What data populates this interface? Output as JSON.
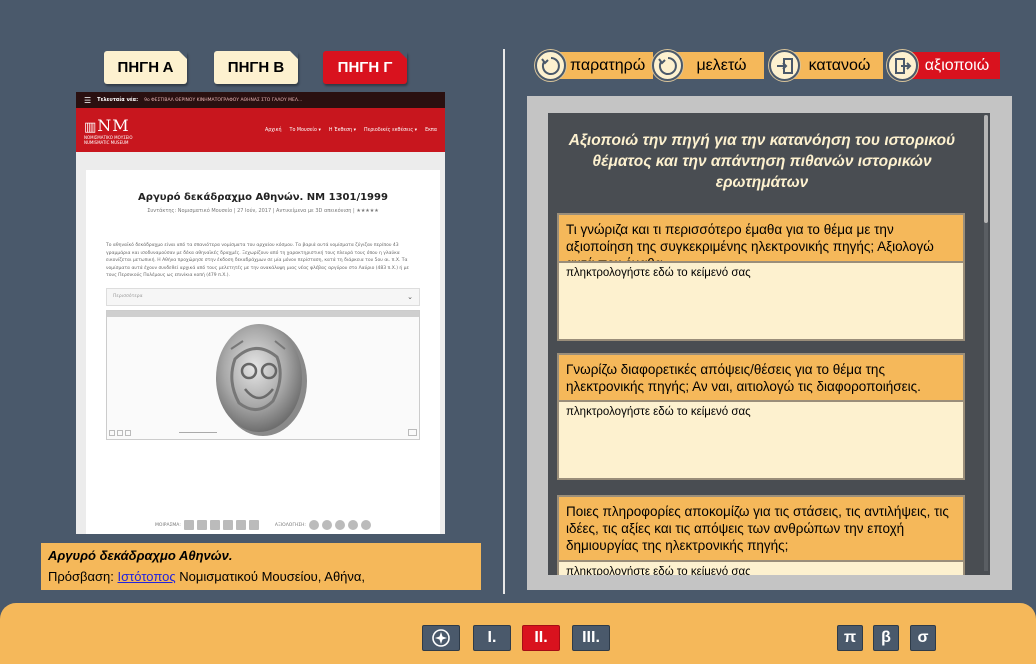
{
  "source_tabs": [
    {
      "label": "ΠΗΓΗ Α",
      "active": false
    },
    {
      "label": "ΠΗΓΗ Β",
      "active": false
    },
    {
      "label": "ΠΗΓΗ Γ",
      "active": true
    }
  ],
  "webpage": {
    "topbar_label": "Τελευταία νέα:",
    "topbar_text": "9ο ΦΕΣΤΙΒΑΛ ΘΕΡΙΝΟΥ ΚΙΝΗΜΑΤΟΓΡΑΦΟΥ ΑΘΗΝΑΣ ΣΤΟ ΓΑΛΟΥ ΜΕΛ...",
    "logo_text": "NM",
    "logo_sub1": "ΝΟΜΙΣΜΑΤΙΚΟ ΜΟΥΣΕΙΟ",
    "logo_sub2": "NUMISMATIC MUSEUM",
    "nav": [
      "Αρχική",
      "Το Μουσείο ▾",
      "Η Έκθεση ▾",
      "Περιοδικές εκθέσεις ▾",
      "Εκπα"
    ],
    "title": "Αργυρό δεκάδραχμο Αθηνών. ΝΜ 1301/1999",
    "meta": "Συντάκτης: Νομισματικό Μουσείο | 27 Ιούν, 2017 | Αντικείμενα με 3D απεικόνιση | ★★★★★",
    "paragraph": "Το αθηναϊκό δεκάδραχμο είναι από τα σπανιότερα νομίσματα του αρχαίου κόσμου. Τα βαριά αυτά νομίσματα ζύγιζαν περίπου 43 γραμμάρια και ισοδυναμούσαν με δέκα αθηναϊκές δραχμές. Ξεχωρίζουν από τη χαρακτηριστική τους πλευρά τους όπου η γλαύκα εικονίζεται μετωπική. Η Αθήνα προχώρησε στην έκδοση δεκαδράχμων σε μία μόνον περίσταση, κατά τη διάρκεια του 5ου αι. π.Χ. Τα νομίσματα αυτά έχουν συνδεθεί αρχικά από τους μελετητές με την ανακάλυψη μιας νέας φλέβας αργύρου στο Λαύριο (483 π.Χ.) ή με τους Περσικούς Πολέμους ως επινίκια κοπή (479 π.Χ.).",
    "select_placeholder": "Περισσότερα",
    "share_label": "ΜΟΙΡΑΣΜΑ:",
    "rate_label": "ΑΞΙΟΛΟΓΗΣΗ:"
  },
  "caption": {
    "title": "Αργυρό δεκάδραχμο Αθηνών.",
    "access_prefix": "Πρόσβαση: ",
    "link_text": "Ιστότοπος",
    "access_suffix": " Νομισματικού Μουσείου, Αθήνα,"
  },
  "steps": [
    {
      "label": "παρατηρώ",
      "icon": "cycle-icon",
      "active": false
    },
    {
      "label": "μελετώ",
      "icon": "cycle-icon",
      "active": false
    },
    {
      "label": "κατανοώ",
      "icon": "enter-icon",
      "active": false
    },
    {
      "label": "αξιοποιώ",
      "icon": "exit-icon",
      "active": true
    }
  ],
  "panel": {
    "heading": "Αξιοποιώ την πηγή για την κατανόηση του ιστορικού θέματος και την απάντηση πιθανών ιστορικών ερωτημάτων",
    "questions": [
      {
        "text": "Τι γνώριζα και τι περισσότερο έμαθα για το θέμα με την αξιοποίηση της συγκεκριμένης ηλεκτρονικής πηγής; Αξιολογώ αυτά που έμαθα.",
        "placeholder": "πληκτρολογήστε εδώ το κείμενό σας"
      },
      {
        "text": "Γνωρίζω διαφορετικές απόψεις/θέσεις για το θέμα της ηλεκτρονικής πηγής; Αν ναι, αιτιολογώ τις διαφοροποιήσεις.",
        "placeholder": "πληκτρολογήστε εδώ το κείμενό σας"
      },
      {
        "text": "Ποιες πληροφορίες αποκομίζω για τις στάσεις, τις αντιλήψεις, τις ιδέες, τις αξίες και τις απόψεις των ανθρώπων την εποχή δημιουργίας της ηλεκτρονικής πηγής;",
        "placeholder": "πληκτρολογήστε εδώ το κείμενό σας"
      }
    ]
  },
  "bottom_nav": {
    "compass_icon": "compass-icon",
    "sections": [
      {
        "label": "I.",
        "active": false
      },
      {
        "label": "II.",
        "active": true
      },
      {
        "label": "III.",
        "active": false
      }
    ],
    "letters": [
      "π",
      "β",
      "σ"
    ]
  },
  "colors": {
    "background": "#4a596b",
    "accent_orange": "#f5b85a",
    "accent_red": "#d9121e",
    "cream": "#fdf1cf",
    "panel_dark": "#494d52"
  }
}
